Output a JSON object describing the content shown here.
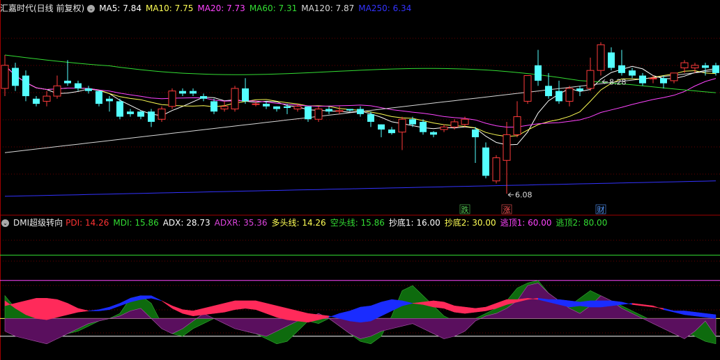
{
  "chart_data": [
    {
      "type": "candlestick",
      "title": "汇嘉时代(日线 前复权)",
      "ylim": [
        5.9,
        9.6
      ],
      "ma": [
        {
          "name": "MA5",
          "value": "7.84",
          "color": "#ffffff"
        },
        {
          "name": "MA10",
          "value": "7.75",
          "color": "#ffff55"
        },
        {
          "name": "MA20",
          "value": "7.73",
          "color": "#ff44ff"
        },
        {
          "name": "MA60",
          "value": "7.31",
          "color": "#33dd33"
        },
        {
          "name": "MA120",
          "value": "7.87",
          "color": "#d8d8d8"
        },
        {
          "name": "MA250",
          "value": "6.34",
          "color": "#3333ff"
        }
      ],
      "candles": [
        [
          8.15,
          8.6,
          8.1,
          8.8,
          8.0
        ],
        [
          8.55,
          8.2,
          8.1,
          8.65,
          8.1
        ],
        [
          8.4,
          8.0,
          7.9,
          8.5,
          7.9
        ],
        [
          7.95,
          7.85,
          7.8,
          8.0,
          7.8
        ],
        [
          7.9,
          8.0,
          7.88,
          8.1,
          7.8
        ],
        [
          8.0,
          8.2,
          8.0,
          8.4,
          7.95
        ],
        [
          8.3,
          8.25,
          8.2,
          8.7,
          8.2
        ],
        [
          8.25,
          8.15,
          8.1,
          8.3,
          8.1
        ],
        [
          8.15,
          8.1,
          8.05,
          8.2,
          8.05
        ],
        [
          8.1,
          7.85,
          7.85,
          8.1,
          7.8
        ],
        [
          7.95,
          7.9,
          7.85,
          8.0,
          7.7
        ],
        [
          7.9,
          7.6,
          7.6,
          7.95,
          7.55
        ],
        [
          7.7,
          7.65,
          7.6,
          7.75,
          7.6
        ],
        [
          7.7,
          7.6,
          7.6,
          7.72,
          7.55
        ],
        [
          7.7,
          7.5,
          7.45,
          7.75,
          7.4
        ],
        [
          7.55,
          7.75,
          7.5,
          7.8,
          7.5
        ],
        [
          7.8,
          8.1,
          7.8,
          8.15,
          7.75
        ],
        [
          8.1,
          8.05,
          8.05,
          8.15,
          8.0
        ],
        [
          8.1,
          8.05,
          8.0,
          8.15,
          8.0
        ],
        [
          8.0,
          7.95,
          7.95,
          8.05,
          7.9
        ],
        [
          7.9,
          7.7,
          7.7,
          7.95,
          7.65
        ],
        [
          7.75,
          7.8,
          7.75,
          7.9,
          7.7
        ],
        [
          7.75,
          8.15,
          7.75,
          8.2,
          7.7
        ],
        [
          8.15,
          7.9,
          7.9,
          8.35,
          7.85
        ],
        [
          7.85,
          7.85,
          7.85,
          7.9,
          7.8
        ],
        [
          7.85,
          7.8,
          7.8,
          7.9,
          7.75
        ],
        [
          7.8,
          7.75,
          7.75,
          7.8,
          7.7
        ],
        [
          7.8,
          7.77,
          7.75,
          7.85,
          7.65
        ],
        [
          7.75,
          7.8,
          7.75,
          7.85,
          7.7
        ],
        [
          7.8,
          7.55,
          7.55,
          7.8,
          7.5
        ],
        [
          7.55,
          7.75,
          7.55,
          7.8,
          7.5
        ],
        [
          7.75,
          7.7,
          7.65,
          7.8,
          7.65
        ],
        [
          7.7,
          7.72,
          7.7,
          7.8,
          7.65
        ],
        [
          7.75,
          7.72,
          7.7,
          7.75,
          7.7
        ],
        [
          7.75,
          7.65,
          7.65,
          7.8,
          7.6
        ],
        [
          7.65,
          7.5,
          7.5,
          7.7,
          7.4
        ],
        [
          7.45,
          7.35,
          7.3,
          7.45,
          7.2
        ],
        [
          7.35,
          7.28,
          7.25,
          7.4,
          7.25
        ],
        [
          7.3,
          7.55,
          7.3,
          7.6,
          6.95
        ],
        [
          7.55,
          7.45,
          7.4,
          7.6,
          7.4
        ],
        [
          7.5,
          7.3,
          7.3,
          7.55,
          7.25
        ],
        [
          7.3,
          7.25,
          7.25,
          7.32,
          7.2
        ],
        [
          7.35,
          7.4,
          7.3,
          7.45,
          7.3
        ],
        [
          7.4,
          7.5,
          7.4,
          7.55,
          7.35
        ],
        [
          7.45,
          7.55,
          7.45,
          7.6,
          7.4
        ],
        [
          7.35,
          7.2,
          7.2,
          7.4,
          6.7
        ],
        [
          7.0,
          6.45,
          6.45,
          7.1,
          6.4
        ],
        [
          6.35,
          6.8,
          6.35,
          6.85,
          6.3
        ],
        [
          6.75,
          7.25,
          6.75,
          7.5,
          6.1
        ],
        [
          7.25,
          7.6,
          7.25,
          7.9,
          7.2
        ],
        [
          7.9,
          8.4,
          7.9,
          8.4,
          7.85
        ],
        [
          8.6,
          8.3,
          8.2,
          8.9,
          8.2
        ],
        [
          8.2,
          8.0,
          7.95,
          8.45,
          7.95
        ],
        [
          8.1,
          7.9,
          7.85,
          8.3,
          7.85
        ],
        [
          7.9,
          8.15,
          7.9,
          8.2,
          7.8
        ],
        [
          8.15,
          8.1,
          8.05,
          8.2,
          8.0
        ],
        [
          8.15,
          8.5,
          8.15,
          8.75,
          8.1
        ],
        [
          8.5,
          9.0,
          8.5,
          9.05,
          8.4
        ],
        [
          8.85,
          8.55,
          8.5,
          8.95,
          8.5
        ],
        [
          8.6,
          8.45,
          8.4,
          8.9,
          8.4
        ],
        [
          8.5,
          8.4,
          8.4,
          8.55,
          8.35
        ],
        [
          8.4,
          8.25,
          8.25,
          8.45,
          8.2
        ],
        [
          8.35,
          8.35,
          8.3,
          8.4,
          8.25
        ],
        [
          8.35,
          8.25,
          8.2,
          8.4,
          8.15
        ],
        [
          8.3,
          8.45,
          8.3,
          8.45,
          8.25
        ],
        [
          8.55,
          8.65,
          8.45,
          8.7,
          8.45
        ],
        [
          8.55,
          8.6,
          8.55,
          8.65,
          8.45
        ],
        [
          8.6,
          8.55,
          8.45,
          8.65,
          8.4
        ],
        [
          8.6,
          8.45,
          8.45,
          8.65,
          8.4
        ]
      ],
      "price_labels": [
        {
          "text": "8.28",
          "value": 8.28
        },
        {
          "text": "6.08",
          "value": 6.08
        }
      ],
      "markers": [
        {
          "text": "跌",
          "color": "#55cc55",
          "border": "#55cc55"
        },
        {
          "text": "涨",
          "color": "#ff5555",
          "border": "#ff5555"
        },
        {
          "text": "财",
          "color": "#5599ff",
          "border": "#5599ff"
        }
      ]
    },
    {
      "type": "area",
      "title": "DMI超级转向",
      "ylim": [
        0,
        100
      ],
      "legend": [
        {
          "name": "PDI",
          "value": "14.26",
          "color": "#ff3333"
        },
        {
          "name": "MDI",
          "value": "15.86",
          "color": "#33dd33"
        },
        {
          "name": "ADX",
          "value": "28.73",
          "color": "#ffffff"
        },
        {
          "name": "ADXR",
          "value": "35.36",
          "color": "#dd44dd"
        },
        {
          "name": "多头线",
          "value": "14.26",
          "color": "#ffff55"
        },
        {
          "name": "空头线",
          "value": "15.86",
          "color": "#33dd33"
        },
        {
          "name": "抄底1",
          "value": "16.00",
          "color": "#ffffff"
        },
        {
          "name": "抄底2",
          "value": "30.00",
          "color": "#ffff55"
        },
        {
          "name": "逃顶1",
          "value": "60.00",
          "color": "#ff44ff"
        },
        {
          "name": "逃顶2",
          "value": "80.00",
          "color": "#33dd33"
        }
      ],
      "levels": [
        {
          "value": 16,
          "color": "#ffffff"
        },
        {
          "value": 30,
          "color": "#ffff55"
        },
        {
          "value": 60,
          "color": "#ff44ff"
        },
        {
          "value": 80,
          "color": "#33dd33"
        }
      ],
      "pdi": [
        40,
        42,
        44,
        46,
        46,
        45,
        42,
        38,
        36,
        36,
        37,
        40,
        43,
        45,
        46,
        44,
        40,
        37,
        36,
        38,
        40,
        42,
        44,
        44,
        44,
        42,
        40,
        38,
        36,
        34,
        33,
        32,
        30,
        28,
        27,
        28,
        32,
        36,
        40,
        42,
        43,
        44,
        43,
        40,
        39,
        38,
        39,
        42,
        45,
        45,
        46,
        45,
        43,
        41,
        39,
        40,
        39,
        39,
        40,
        41,
        42,
        41,
        40,
        37,
        35,
        33,
        32,
        31,
        30
      ],
      "mdi": [
        44,
        38,
        33,
        30,
        29,
        31,
        33,
        35,
        36,
        37,
        39,
        42,
        46,
        48,
        48,
        44,
        38,
        34,
        32,
        33,
        34,
        35,
        37,
        38,
        37,
        34,
        31,
        29,
        28,
        27,
        29,
        31,
        34,
        36,
        39,
        40,
        43,
        45,
        44,
        42,
        41,
        39,
        38,
        35,
        34,
        35,
        36,
        38,
        41,
        43,
        45,
        46,
        45,
        45,
        44,
        43,
        44,
        44,
        44,
        43,
        41,
        40,
        39,
        38,
        36,
        36,
        35,
        34,
        33
      ],
      "green_area": [
        48,
        38,
        36,
        32,
        16,
        14,
        18,
        20,
        24,
        28,
        30,
        34,
        46,
        48,
        42,
        26,
        18,
        16,
        22,
        26,
        30,
        28,
        24,
        20,
        18,
        14,
        10,
        12,
        20,
        28,
        26,
        30,
        24,
        18,
        12,
        10,
        16,
        32,
        52,
        56,
        48,
        40,
        32,
        28,
        26,
        30,
        34,
        38,
        44,
        54,
        58,
        60,
        50,
        44,
        40,
        46,
        52,
        48,
        44,
        40,
        36,
        32,
        28,
        26,
        24,
        20,
        16,
        12,
        10
      ],
      "purple_area": [
        20,
        16,
        14,
        12,
        10,
        14,
        18,
        22,
        26,
        28,
        30,
        32,
        36,
        38,
        30,
        22,
        18,
        22,
        28,
        34,
        30,
        26,
        22,
        20,
        18,
        16,
        20,
        24,
        28,
        30,
        34,
        30,
        24,
        18,
        14,
        16,
        20,
        22,
        24,
        26,
        22,
        18,
        14,
        16,
        20,
        28,
        32,
        34,
        38,
        44,
        56,
        58,
        50,
        44,
        38,
        34,
        40,
        48,
        44,
        38,
        34,
        30,
        26,
        22,
        18,
        14,
        20,
        28,
        16
      ]
    }
  ]
}
